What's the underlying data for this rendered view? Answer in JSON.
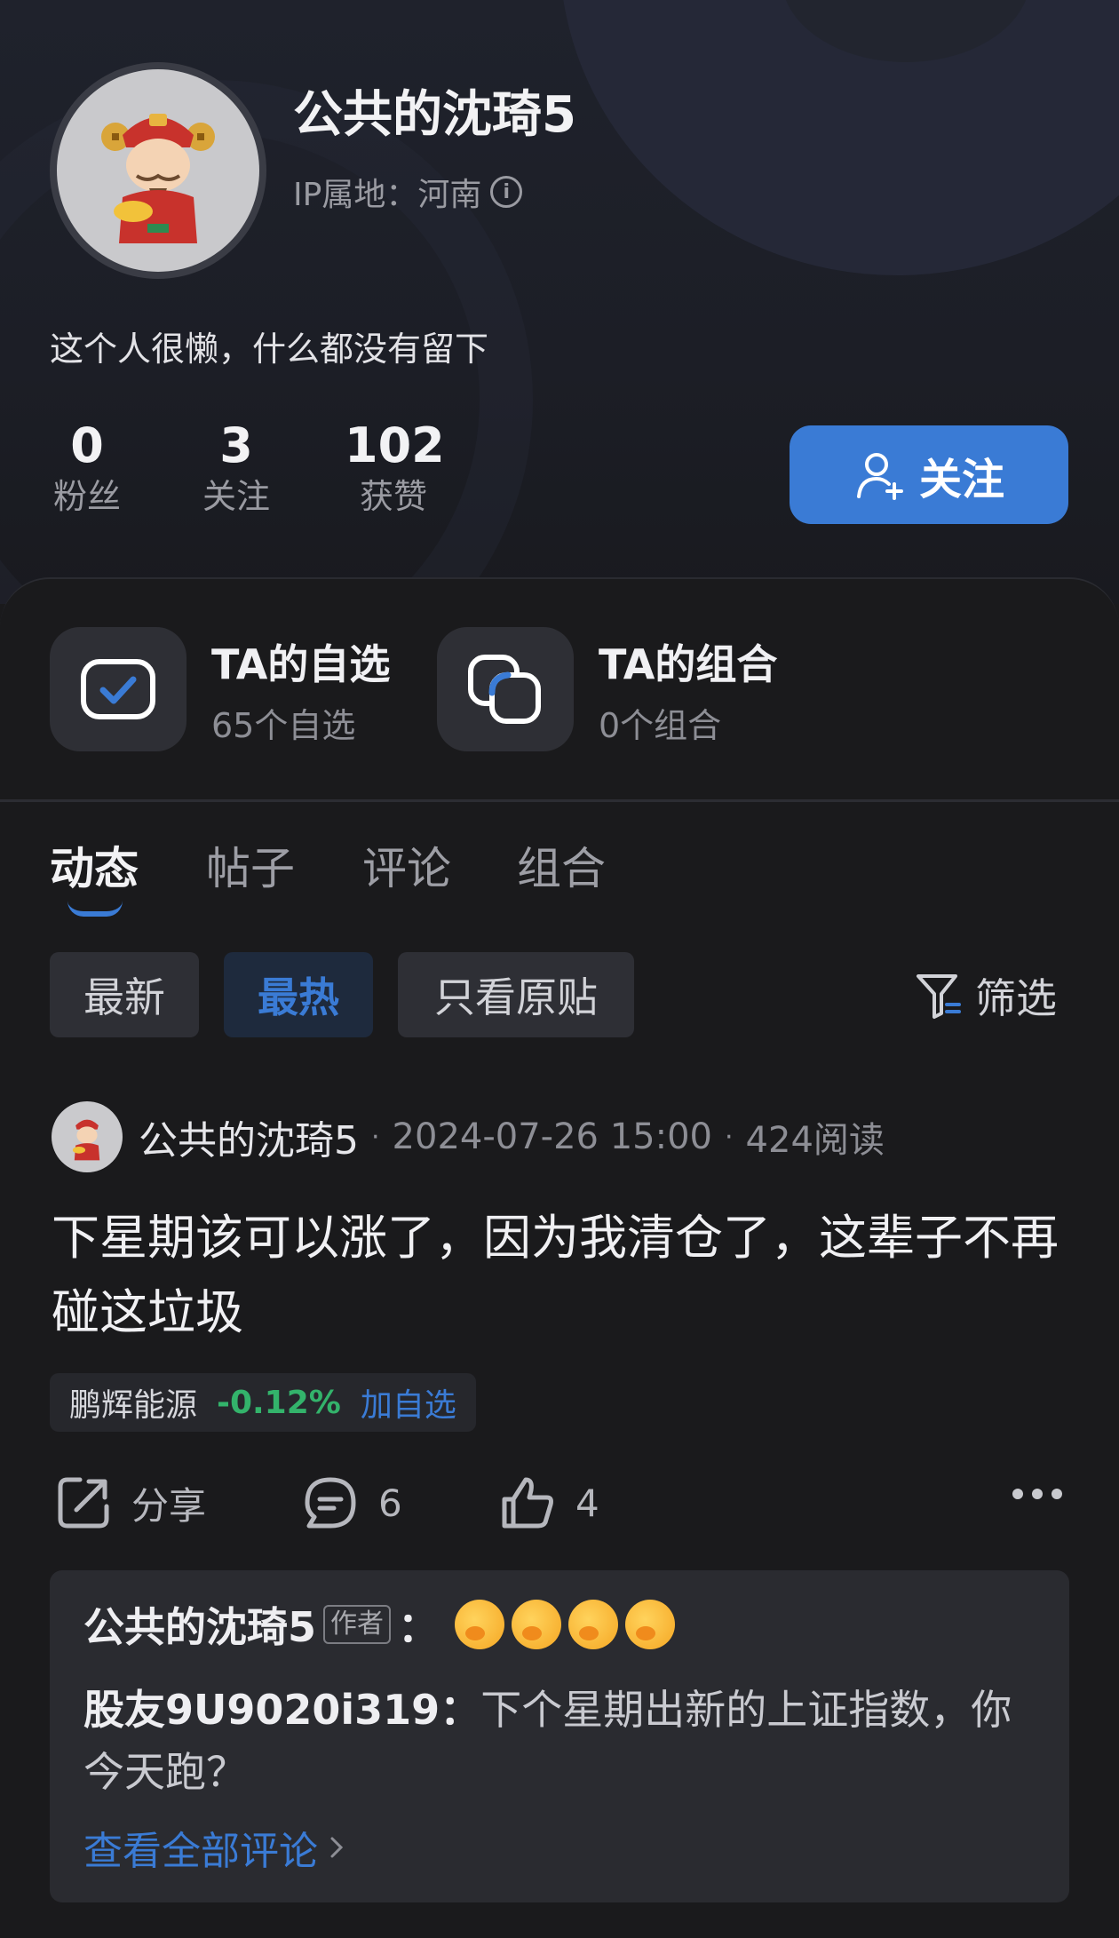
{
  "profile": {
    "username": "公共的沈琦5",
    "ip_location": "IP属地：河南",
    "bio": "这个人很懒，什么都没有留下",
    "stats": [
      {
        "num": "0",
        "label": "粉丝"
      },
      {
        "num": "3",
        "label": "关注"
      },
      {
        "num": "102",
        "label": "获赞"
      }
    ],
    "follow_label": "关注"
  },
  "cards": [
    {
      "title": "TA的自选",
      "sub": "65个自选"
    },
    {
      "title": "TA的组合",
      "sub": "0个组合"
    }
  ],
  "tabs": [
    "动态",
    "帖子",
    "评论",
    "组合"
  ],
  "chips": [
    "最新",
    "最热",
    "只看原贴"
  ],
  "filter_label": "筛选",
  "post": {
    "author": "公共的沈琦5",
    "dot": "·",
    "datetime": "2024-07-26 15:00",
    "reads": "424阅读",
    "body": "下星期该可以涨了，因为我清仓了，这辈子不再碰这垃圾",
    "stock": {
      "name": "鹏辉能源",
      "change": "-0.12%",
      "add": "加自选"
    },
    "actions": {
      "share": "分享",
      "comments": "6",
      "likes": "4"
    }
  },
  "comments": {
    "first_author": "公共的沈琦5",
    "author_tag": "作者",
    "colon": "：",
    "second_author": "股友9U9020i319",
    "second_text": "下个星期出新的上证指数，你今天跑？",
    "view_all": "查看全部评论"
  },
  "colors": {
    "accent": "#3a7bd5",
    "down_green": "#33b36b"
  }
}
